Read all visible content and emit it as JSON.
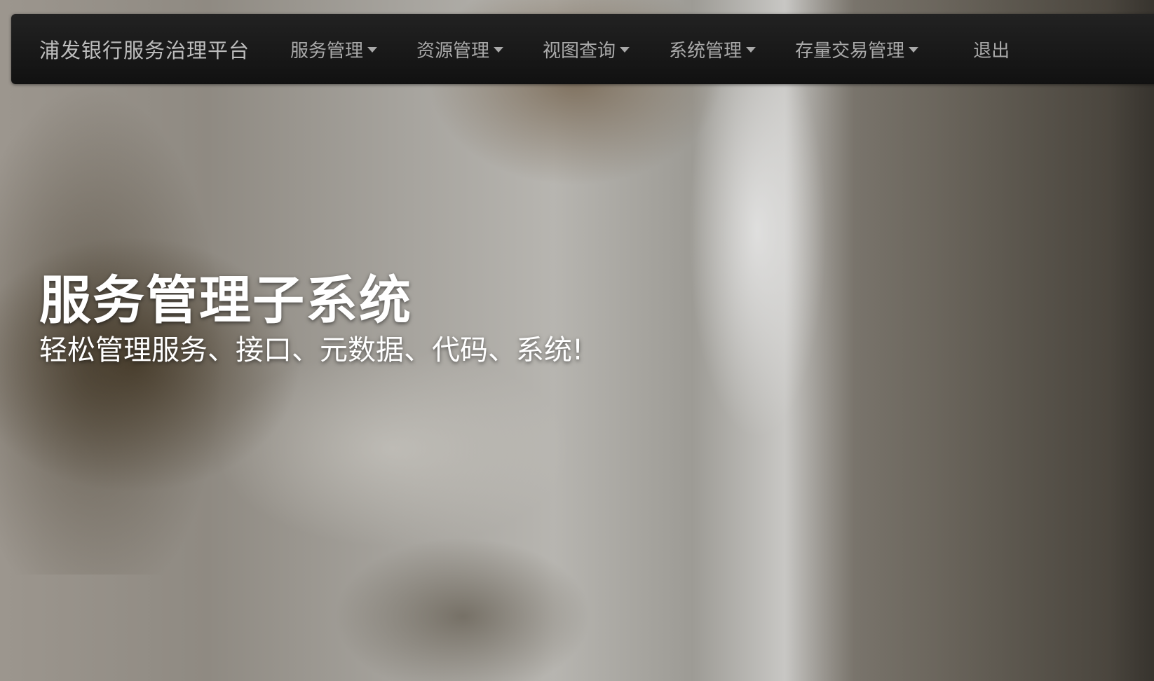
{
  "navbar": {
    "brand": "浦发银行服务治理平台",
    "items": [
      {
        "label": "服务管理"
      },
      {
        "label": "资源管理"
      },
      {
        "label": "视图查询"
      },
      {
        "label": "系统管理"
      },
      {
        "label": "存量交易管理"
      }
    ],
    "logout": "退出"
  },
  "hero": {
    "title": "服务管理子系统",
    "subtitle": "轻松管理服务、接口、元数据、代码、系统!"
  },
  "icons": {
    "dropdown": "caret-down-icon"
  }
}
